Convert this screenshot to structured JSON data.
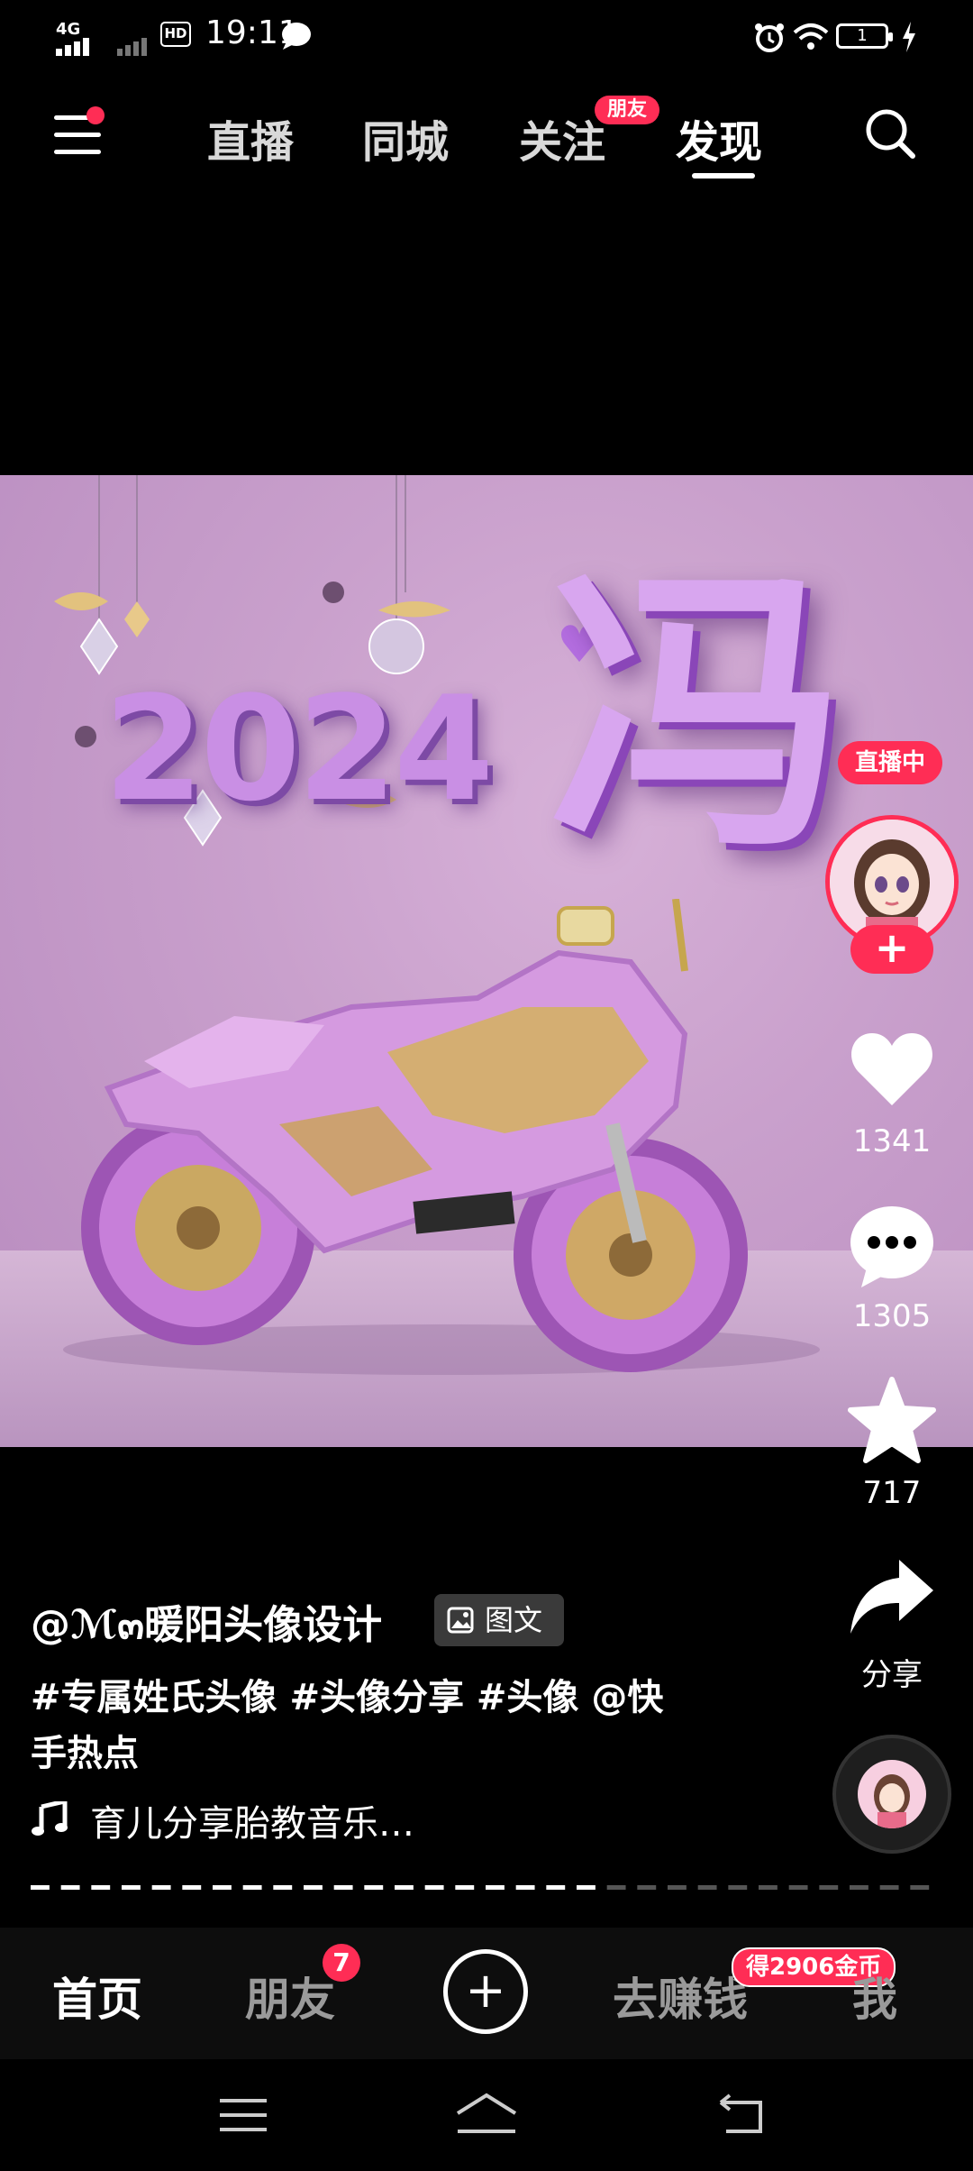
{
  "status_bar": {
    "network": "4G",
    "hd": "HD",
    "time": "19:11",
    "battery": "1"
  },
  "top_nav": {
    "tabs": [
      "直播",
      "同城",
      "关注",
      "发现"
    ],
    "active_tab": "发现",
    "friend_badge": "朋友"
  },
  "media": {
    "year_text": "2024",
    "surname_char": "冯"
  },
  "right_rail": {
    "live_label": "直播中",
    "follow_symbol": "+",
    "likes": "1341",
    "comments": "1305",
    "favorites": "717",
    "share_label": "分享"
  },
  "caption": {
    "author": "@ℳ๓暖阳头像设计",
    "type_tag": "图文",
    "tags_text": "#专属姓氏头像 #头像分享 #头像 @快手热点",
    "music": "育儿分享胎教音乐…"
  },
  "bottom_nav": {
    "home": "首页",
    "friends": "朋友",
    "friends_badge": "7",
    "add_symbol": "+",
    "earn": "去赚钱",
    "earn_badge": "得2906金币",
    "me": "我"
  },
  "colors": {
    "accent": "#ff2d55",
    "background": "#000000"
  }
}
